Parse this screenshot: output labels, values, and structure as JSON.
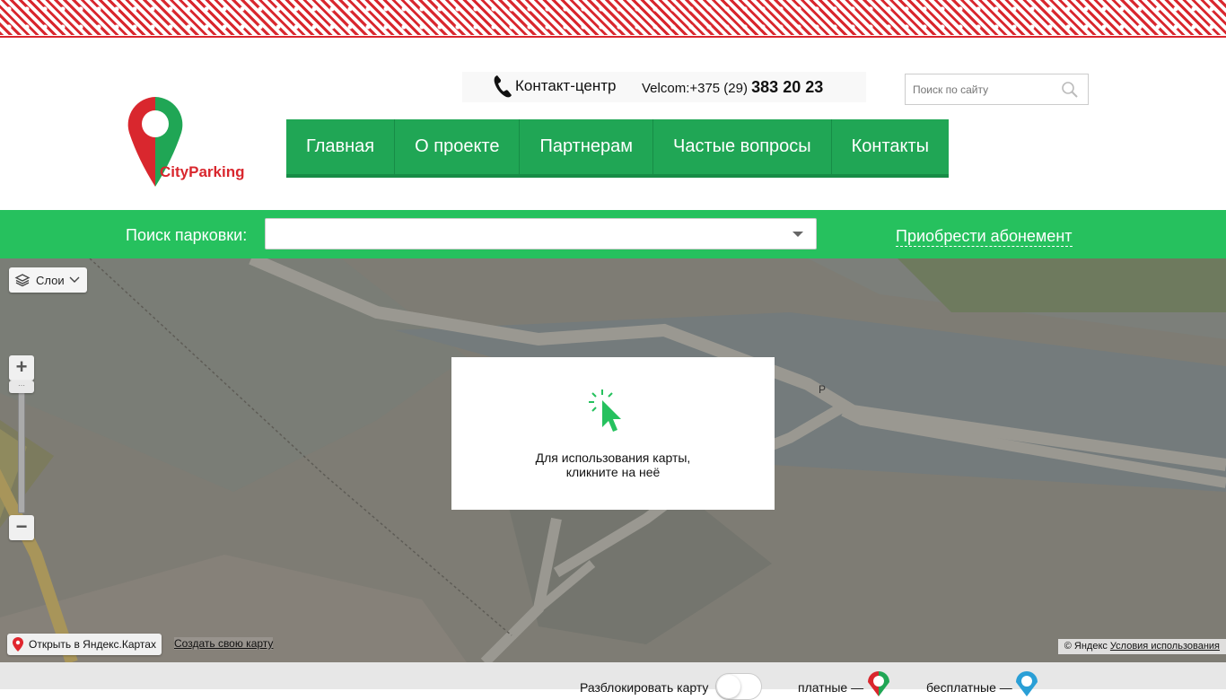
{
  "header": {
    "logo_text": "CityParking",
    "contact_label": "Контакт-центр",
    "contact_prefix": "Velcom:+375 (29) ",
    "contact_number": "383 20 23",
    "search_placeholder": "Поиск по сайту"
  },
  "nav": {
    "items": [
      {
        "label": "Главная"
      },
      {
        "label": "О проекте"
      },
      {
        "label": "Партнерам"
      },
      {
        "label": "Частые вопросы"
      },
      {
        "label": "Контакты"
      }
    ]
  },
  "parking_bar": {
    "search_label": "Поиск парковки:",
    "select_value": "",
    "subscribe_link": "Приобрести абонемент"
  },
  "map": {
    "layers_label": "Слои",
    "zoom_in": "+",
    "zoom_out": "−",
    "overlay_line1": "Для использования карты,",
    "overlay_line2": "кликните на неё",
    "open_yandex": "Открыть в Яндекс.Картах",
    "create_map": "Создать свою карту",
    "copyright": "© Яндекс",
    "terms": "Условия использования"
  },
  "footer": {
    "unlock_label": "Разблокировать карту",
    "paid_label": "платные —",
    "free_label": "бесплатные —"
  },
  "colors": {
    "brand_green": "#26c15e",
    "nav_green": "#20a655",
    "brand_red": "#d9272e",
    "free_blue": "#2a9fd6"
  },
  "icons": [
    "phone-icon",
    "search-icon",
    "layers-icon",
    "chevron-down-icon",
    "map-pin-icon",
    "cursor-click-icon",
    "paid-pin-icon",
    "free-pin-icon"
  ]
}
